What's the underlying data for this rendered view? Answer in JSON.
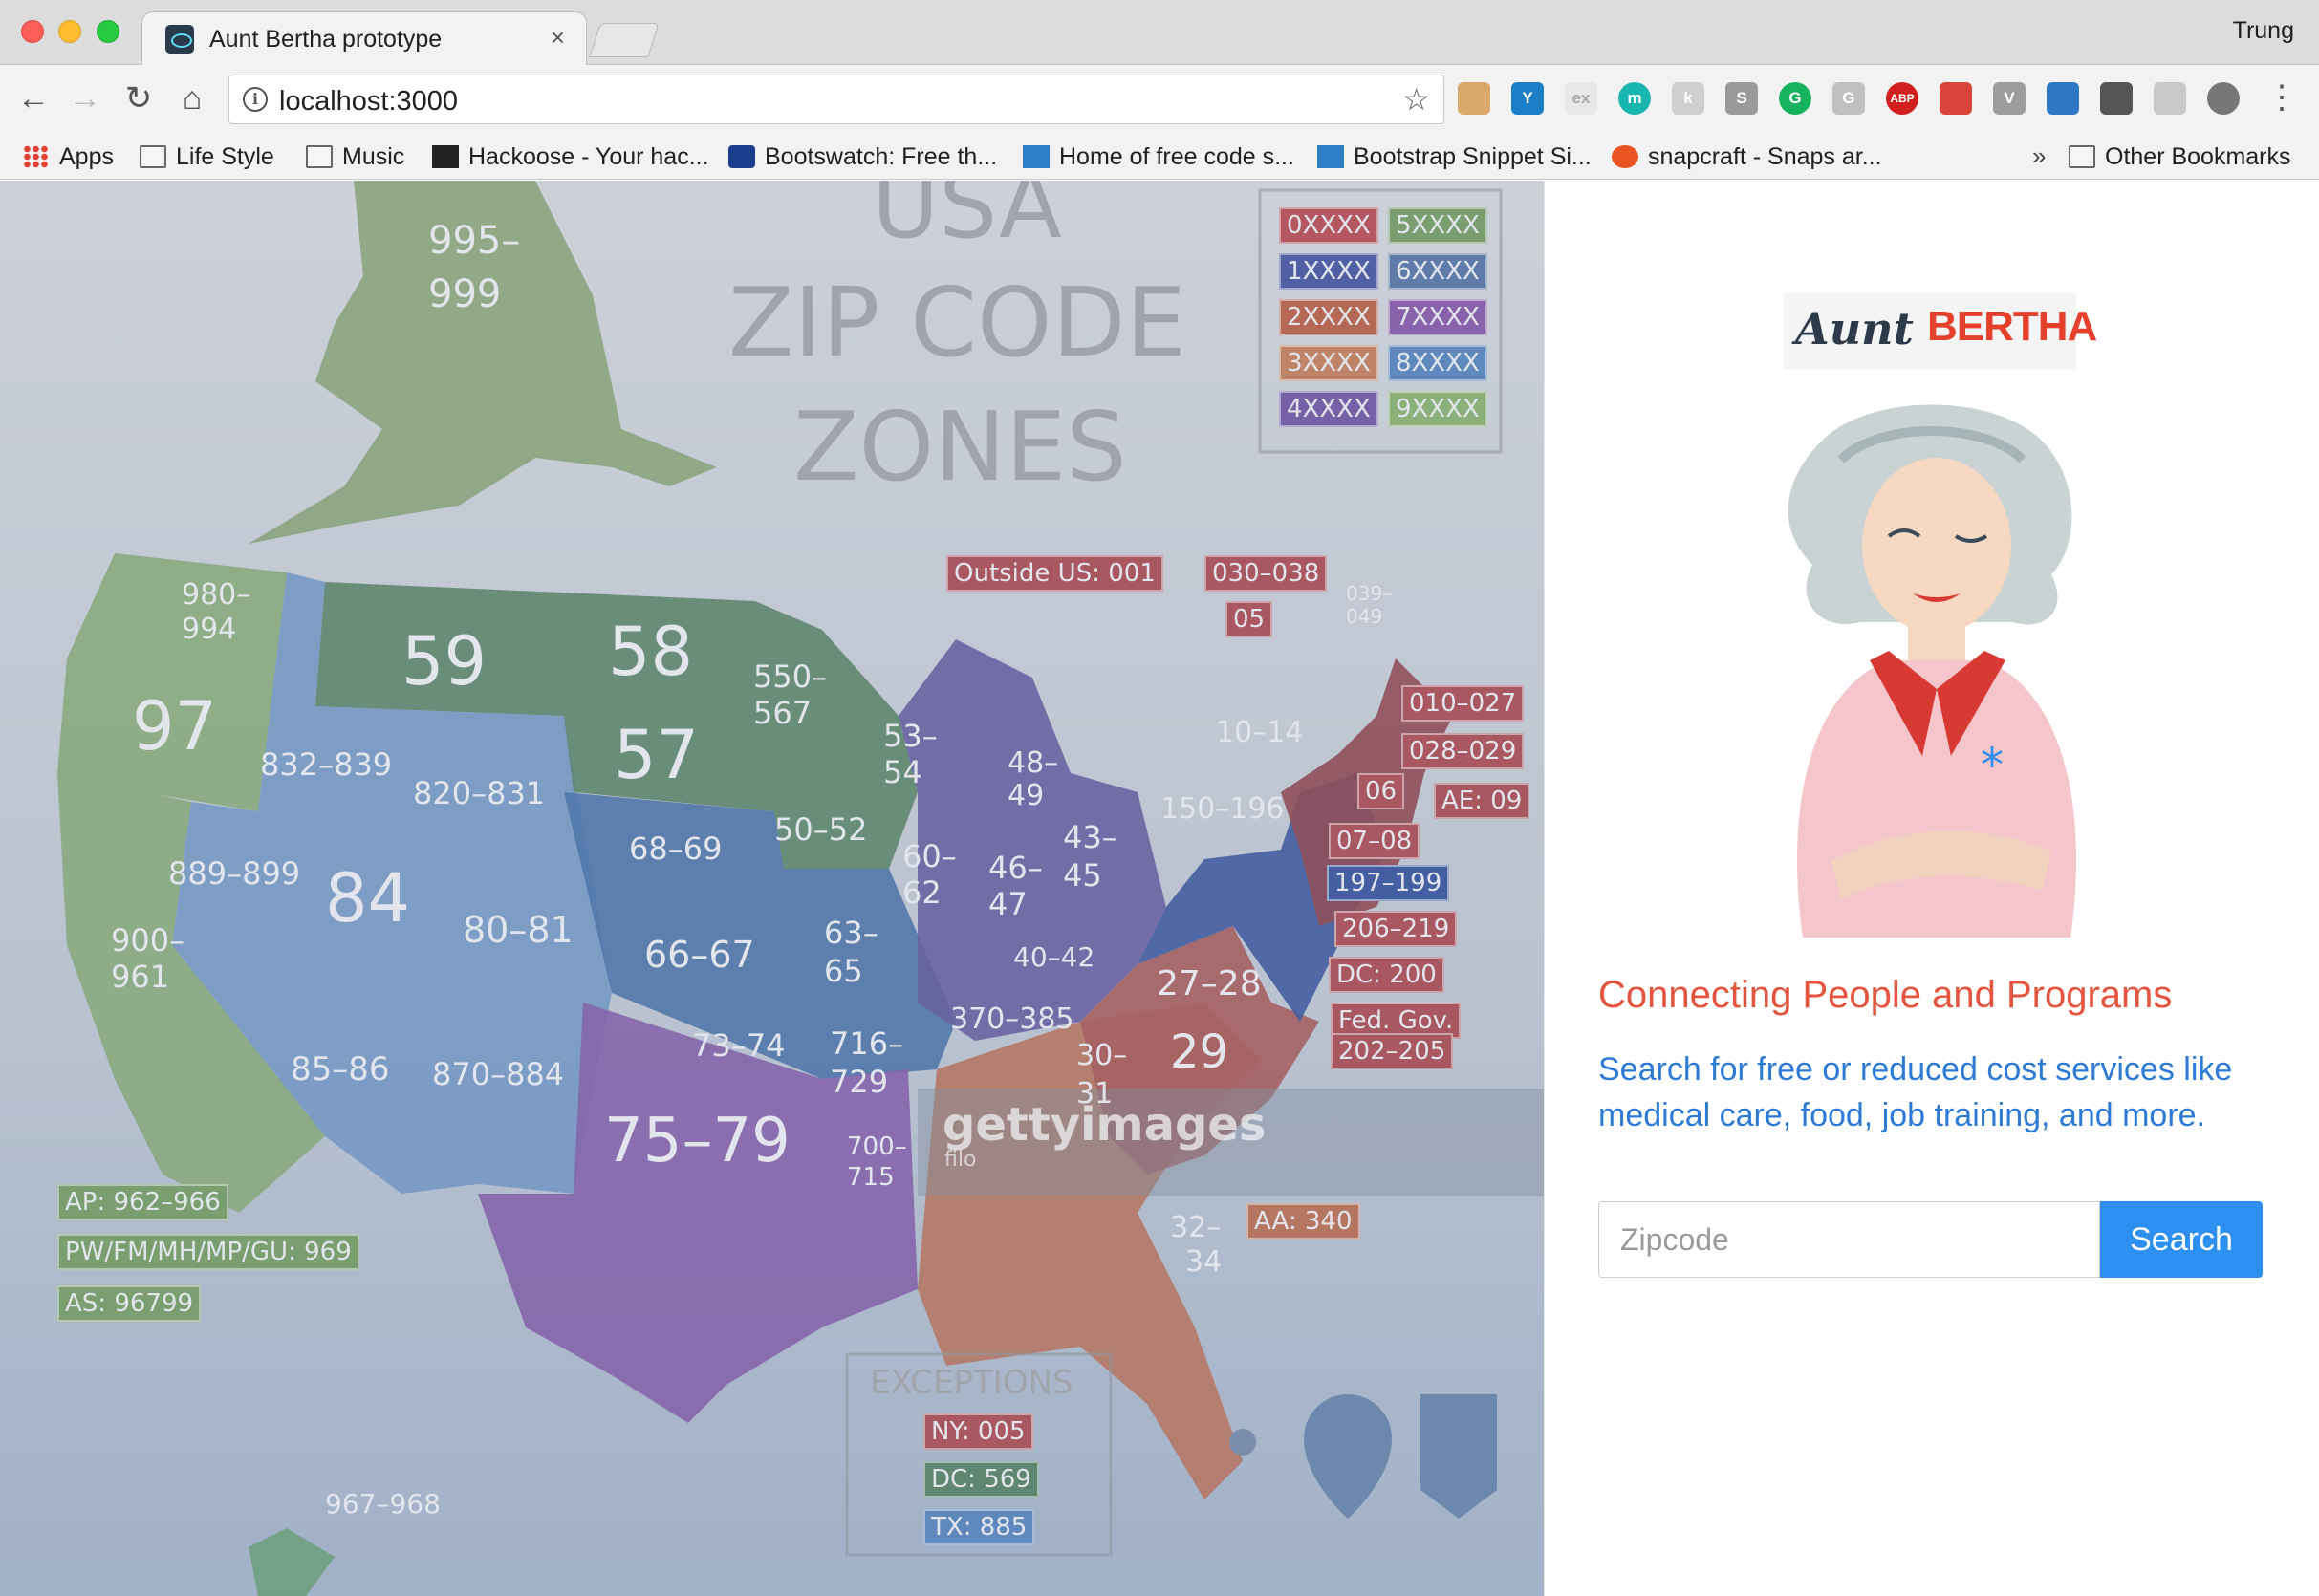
{
  "browser": {
    "tab_title": "Aunt Bertha prototype",
    "tab_close": "×",
    "profile_name": "Trung",
    "url": "localhost:3000",
    "bookmarks": [
      {
        "label": "Apps",
        "icon": "apps-grid-icon"
      },
      {
        "label": "Life Style",
        "icon": "folder-icon"
      },
      {
        "label": "Music",
        "icon": "folder-icon"
      },
      {
        "label": "Hackoose - Your hac...",
        "icon": "hackoose-icon"
      },
      {
        "label": "Bootswatch: Free th...",
        "icon": "bootswatch-icon"
      },
      {
        "label": "Home of free code s...",
        "icon": "bootstrap-snippet-icon"
      },
      {
        "label": "Bootstrap Snippet Si...",
        "icon": "bootstrap-snippet-icon"
      },
      {
        "label": "snapcraft - Snaps ar...",
        "icon": "snapcraft-icon"
      }
    ],
    "bookmarks_overflow": "»",
    "other_bookmarks": "Other Bookmarks",
    "extensions": [
      "ex",
      "m",
      "G",
      "G",
      "ABP"
    ]
  },
  "map": {
    "title_lines": [
      "USA",
      "ZIP CODE",
      "ZONES"
    ],
    "key_labels": [
      "0XXXX",
      "5XXXX",
      "1XXXX",
      "6XXXX",
      "2XXXX",
      "7XXXX",
      "3XXXX",
      "8XXXX",
      "4XXXX",
      "9XXXX"
    ],
    "region_labels": [
      "995–",
      "999",
      "980–",
      "994",
      "97",
      "59",
      "58",
      "57",
      "550–",
      "567",
      "53–",
      "54",
      "48–",
      "49",
      "832–839",
      "820–831",
      "889–899",
      "84",
      "900–",
      "961",
      "68–69",
      "50–52",
      "60–",
      "62",
      "46–",
      "47",
      "43–",
      "45",
      "10–14",
      "150–196",
      "80–81",
      "66–67",
      "63–",
      "65",
      "40–42",
      "85–86",
      "870–884",
      "73–74",
      "716–",
      "729",
      "370–385",
      "27–28",
      "29",
      "75–79",
      "700–",
      "715",
      "30–",
      "31",
      "32–",
      "34",
      "967–968",
      "06",
      "05",
      "039–",
      "049"
    ],
    "tag_labels": [
      "Outside US: 001",
      "030–038",
      "05",
      "010–027",
      "028–029",
      "AE: 09",
      "06",
      "07–08",
      "197–199",
      "206–219",
      "DC: 200",
      "Fed. Gov.",
      "202–205",
      "AA: 340",
      "AP: 962–966",
      "PW/FM/MH/MP/GU: 969",
      "AS: 96799"
    ],
    "exceptions_title": "EXCEPTIONS",
    "exceptions": [
      "NY: 005",
      "DC: 569",
      "TX: 885"
    ],
    "watermark": "gettyimages",
    "watermark_sub": "filo"
  },
  "brand": {
    "logo_aunt": "Aunt",
    "logo_bertha": "BERTHA"
  },
  "search": {
    "heading": "Connecting People and Programs",
    "description": "Search for free or reduced cost services like medical care, food, job training, and more.",
    "placeholder": "Zipcode",
    "button_label": "Search"
  },
  "colors": {
    "heading": "#e4553f",
    "description": "#2d7ad6",
    "button": "#2d90f0"
  }
}
